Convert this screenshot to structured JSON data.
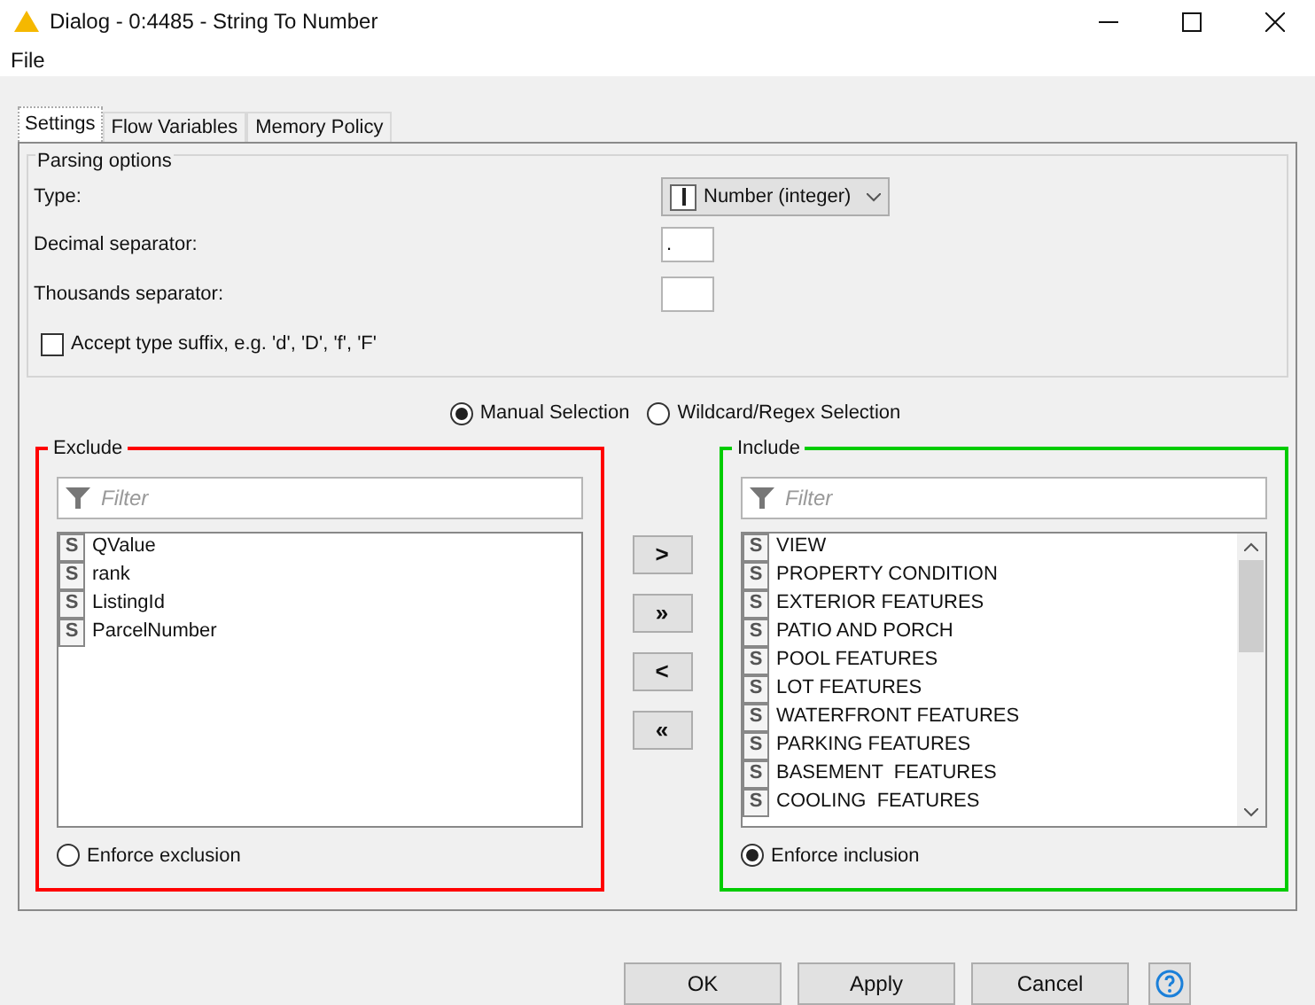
{
  "window": {
    "title": "Dialog - 0:4485 - String To Number"
  },
  "menu": [
    "File"
  ],
  "tabs": [
    {
      "label": "Settings",
      "selected": true
    },
    {
      "label": "Flow Variables",
      "selected": false
    },
    {
      "label": "Memory Policy",
      "selected": false
    }
  ],
  "parsing_options": {
    "title": "Parsing options",
    "type": {
      "label": "Type:",
      "value": "Number (integer)"
    },
    "decimal_separator": {
      "label": "Decimal separator:",
      "value": "."
    },
    "thousands_separator": {
      "label": "Thousands separator:"
    },
    "accept_suffix": {
      "label": "Accept type suffix, e.g. 'd', 'D', 'f', 'F'",
      "checked": false
    }
  },
  "selection_mode": [
    {
      "label": "Manual Selection",
      "selected": true
    },
    {
      "label": "Wildcard/Regex Selection",
      "selected": false
    }
  ],
  "exclude": {
    "title": "Exclude",
    "color": "#ff0000",
    "filter_placeholder": "Filter",
    "items": [
      {
        "type_icon": "S",
        "name": "QValue"
      },
      {
        "type_icon": "S",
        "name": "rank"
      },
      {
        "type_icon": "S",
        "name": "ListingId"
      },
      {
        "type_icon": "S",
        "name": "ParcelNumber"
      }
    ],
    "enforce": {
      "label": "Enforce exclusion",
      "selected": false
    }
  },
  "move_buttons": [
    ">",
    "»",
    "<",
    "«"
  ],
  "include": {
    "title": "Include",
    "color": "#00cc00",
    "filter_placeholder": "Filter",
    "items": [
      {
        "type_icon": "S",
        "name": "VIEW"
      },
      {
        "type_icon": "S",
        "name": "PROPERTY CONDITION"
      },
      {
        "type_icon": "S",
        "name": "EXTERIOR FEATURES"
      },
      {
        "type_icon": "S",
        "name": "PATIO AND PORCH"
      },
      {
        "type_icon": "S",
        "name": "POOL FEATURES"
      },
      {
        "type_icon": "S",
        "name": "LOT FEATURES"
      },
      {
        "type_icon": "S",
        "name": "WATERFRONT FEATURES"
      },
      {
        "type_icon": "S",
        "name": "PARKING FEATURES"
      },
      {
        "type_icon": "S",
        "name": "BASEMENT  FEATURES"
      },
      {
        "type_icon": "S",
        "name": "COOLING  FEATURES"
      }
    ],
    "enforce": {
      "label": "Enforce inclusion",
      "selected": true
    }
  },
  "buttons": [
    "OK",
    "Apply",
    "Cancel"
  ]
}
